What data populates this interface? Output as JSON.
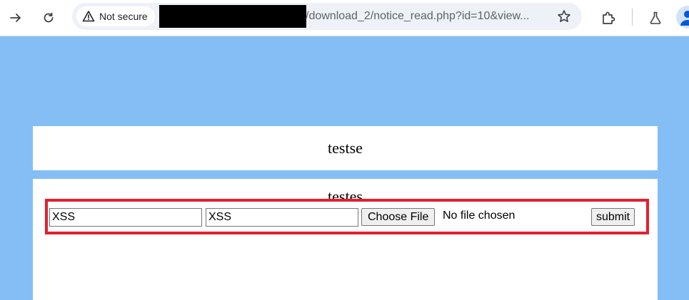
{
  "browser": {
    "security_label": "Not secure",
    "url_path": "/download_2/notice_read.php?id=10&view...",
    "icons": {
      "back": "arrow-right-icon",
      "reload": "reload-icon",
      "warning": "warning-triangle-icon",
      "bookmark": "star-icon",
      "extensions": "puzzle-icon",
      "labs": "flask-icon",
      "profile": "avatar"
    }
  },
  "page": {
    "background_color": "#84bef5",
    "title": "testse",
    "content": "testes",
    "form": {
      "field1_value": "XSS",
      "field2_value": "XSS",
      "file_button_label": "Choose File",
      "file_status": "No file chosen",
      "submit_label": "submit",
      "highlight_color": "#e3202f"
    }
  }
}
